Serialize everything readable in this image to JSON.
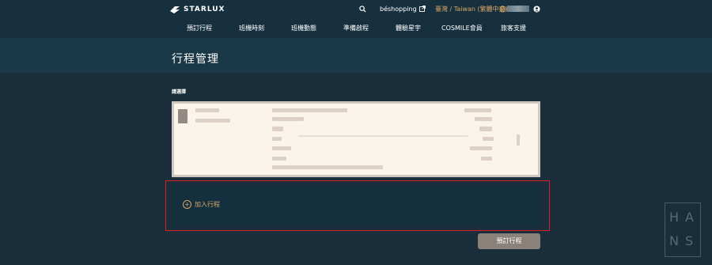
{
  "header": {
    "brand": "STARLUX",
    "utility": {
      "shop_label": "béshopping",
      "language_label": "臺灣 / Taiwan (繁體中文)"
    },
    "nav": [
      "預訂行程",
      "班機時刻",
      "班機動態",
      "準備啟程",
      "體驗星宇",
      "COSMILE會員",
      "旅客支援"
    ]
  },
  "page": {
    "title": "行程管理",
    "section_label": "請選擇"
  },
  "actions": {
    "add_trip": "加入行程",
    "book_trip": "預訂行程"
  },
  "watermark": {
    "letters": [
      "H",
      "A",
      "N",
      "S"
    ]
  },
  "colors": {
    "background": "#1a2d3b",
    "header": "#17303f",
    "accent_gold": "#d9a766",
    "highlight_red": "#e02020",
    "card": "#fbf4ea"
  }
}
